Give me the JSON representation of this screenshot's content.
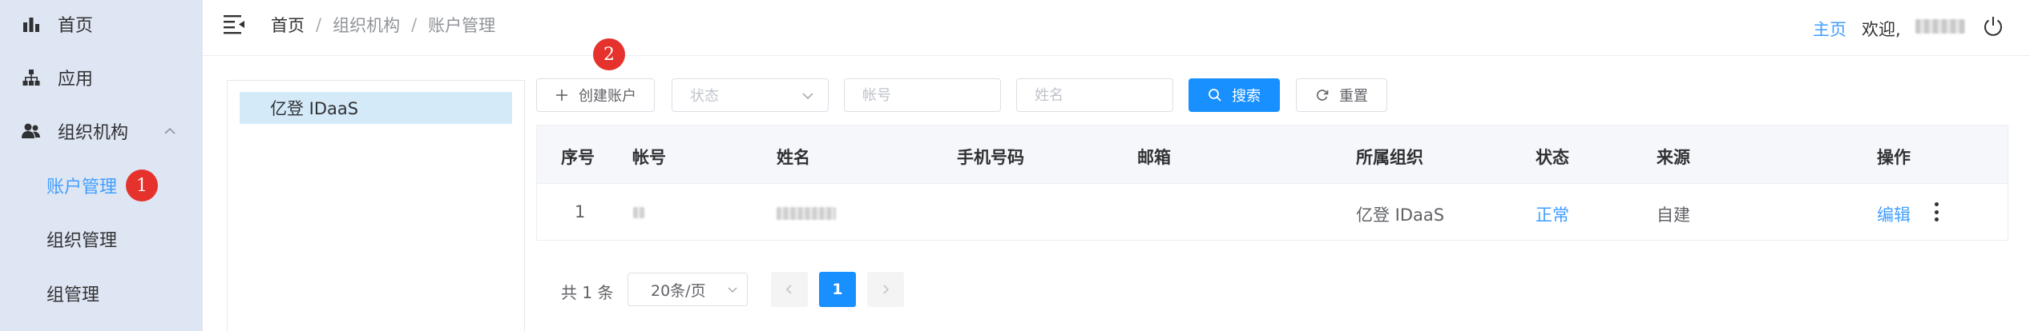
{
  "sidebar": {
    "menu": [
      {
        "label": "首页",
        "icon": "bar-chart-icon"
      },
      {
        "label": "应用",
        "icon": "sitemap-icon"
      },
      {
        "label": "组织机构",
        "icon": "users-icon"
      }
    ],
    "submenu": [
      {
        "label": "账户管理",
        "active": true
      },
      {
        "label": "组织管理",
        "active": false
      },
      {
        "label": "组管理",
        "active": false
      }
    ],
    "badge1": "1"
  },
  "header": {
    "breadcrumb": [
      "首页",
      "组织机构",
      "账户管理"
    ],
    "separator": "/",
    "home_link": "主页",
    "welcome": "欢迎,"
  },
  "tree": {
    "root": "亿登 IDaaS"
  },
  "toolbar": {
    "create_label": "创建账户",
    "badge2": "2",
    "status_placeholder": "状态",
    "account_placeholder": "帐号",
    "name_placeholder": "姓名",
    "search_label": "搜索",
    "reset_label": "重置"
  },
  "table": {
    "headers": [
      "序号",
      "帐号",
      "姓名",
      "手机号码",
      "邮箱",
      "所属组织",
      "状态",
      "来源",
      "操作"
    ],
    "rows": [
      {
        "index": "1",
        "organization": "亿登 IDaaS",
        "status": "正常",
        "source": "自建",
        "action": "编辑"
      }
    ]
  },
  "pagination": {
    "total": "共 1 条",
    "page_size": "20条/页",
    "current_page": "1"
  },
  "colors": {
    "primary": "#1890ff",
    "link": "#409eff",
    "badge": "#e5322d",
    "sidebar_bg": "#dfe6f3",
    "tree_selected": "#d4eaf9"
  }
}
